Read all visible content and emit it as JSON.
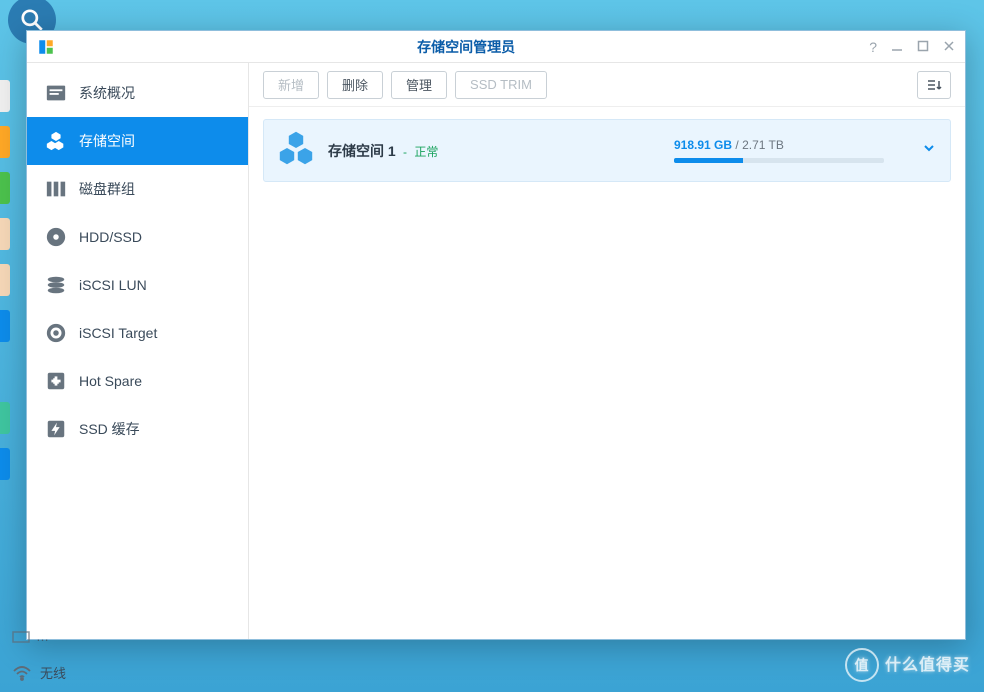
{
  "window": {
    "title": "存储空间管理员"
  },
  "sidebar": {
    "items": [
      {
        "label": "系统概况",
        "icon": "overview"
      },
      {
        "label": "存储空间",
        "icon": "volume",
        "active": true
      },
      {
        "label": "磁盘群组",
        "icon": "diskgroup"
      },
      {
        "label": "HDD/SSD",
        "icon": "hdd"
      },
      {
        "label": "iSCSI LUN",
        "icon": "lun"
      },
      {
        "label": "iSCSI Target",
        "icon": "target"
      },
      {
        "label": "Hot Spare",
        "icon": "hotspare"
      },
      {
        "label": "SSD 缓存",
        "icon": "ssdcache"
      }
    ]
  },
  "toolbar": {
    "add": "新增",
    "delete": "删除",
    "manage": "管理",
    "ssdtrim": "SSD TRIM"
  },
  "volume": {
    "name": "存储空间 1",
    "status_sep": " - ",
    "status": "正常",
    "used": "918.91 GB",
    "sep": " / ",
    "total": "2.71 TB",
    "used_percent": 33
  },
  "desktop": {
    "wifi": "无线"
  },
  "watermark": {
    "text": "什么值得买",
    "bubble": "值"
  }
}
